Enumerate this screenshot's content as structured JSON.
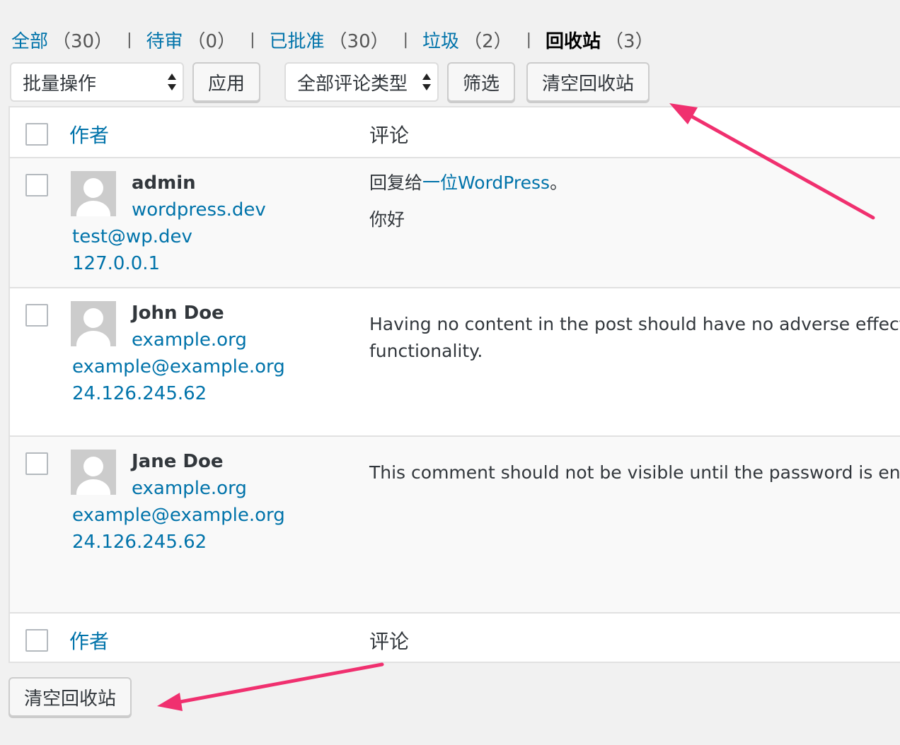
{
  "filters": [
    {
      "label": "全部",
      "count": "（30）"
    },
    {
      "label": "待审",
      "count": "（0）"
    },
    {
      "label": "已批准",
      "count": "（30）"
    },
    {
      "label": "垃圾",
      "count": "（2）"
    },
    {
      "label": "回收站",
      "count": "（3）",
      "current": true
    }
  ],
  "separator": "|",
  "toolbar": {
    "bulk_select": "批量操作",
    "apply_label": "应用",
    "type_select": "全部评论类型",
    "filter_label": "筛选",
    "empty_trash_label": "清空回收站"
  },
  "table": {
    "col_author": "作者",
    "col_comment": "评论",
    "rows": [
      {
        "name": "admin",
        "url": "wordpress.dev",
        "email": "test@wp.dev",
        "ip": "127.0.0.1",
        "reply_prefix": "回复给",
        "reply_link": "一位WordPress",
        "reply_suffix": "。",
        "text": "你好"
      },
      {
        "name": "John Doe",
        "url": "example.org",
        "email": "example@example.org",
        "ip": "24.126.245.62",
        "text_line1": "Having no content in the post should have no adverse effects",
        "text_line2": "functionality."
      },
      {
        "name": "Jane Doe",
        "url": "example.org",
        "email": "example@example.org",
        "ip": "24.126.245.62",
        "text_line1": "This comment should not be visible until the password is ente"
      }
    ]
  },
  "bottom": {
    "empty_trash_label": "清空回收站"
  },
  "colors": {
    "link": "#0073aa",
    "annotation_arrow": "#f0306f",
    "background": "#f1f1f1"
  }
}
